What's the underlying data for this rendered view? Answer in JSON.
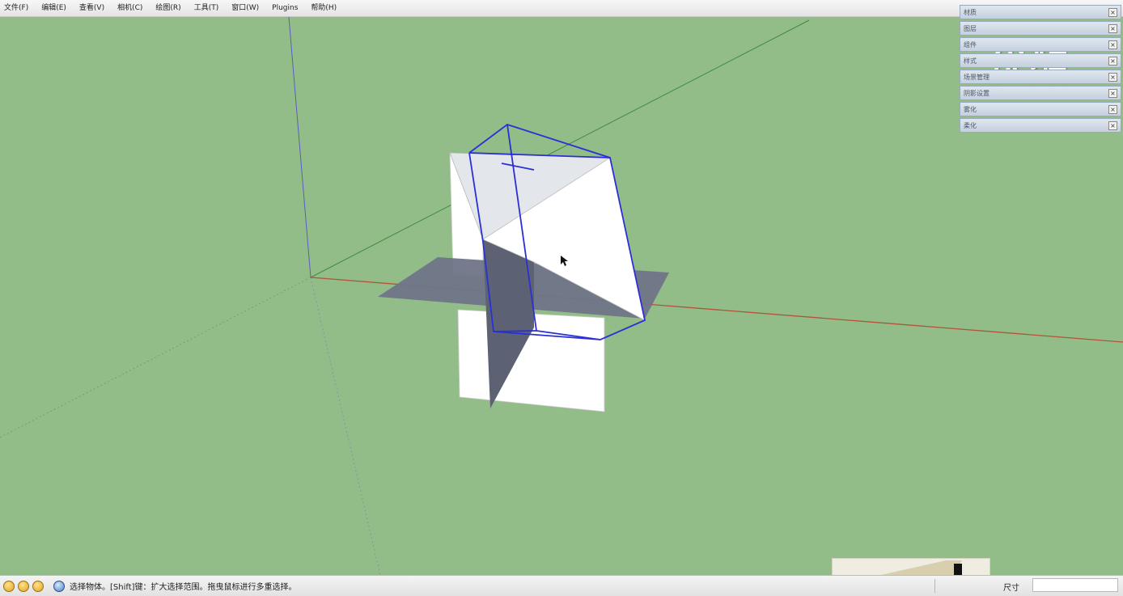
{
  "menu": [
    "文件(F)",
    "编辑(E)",
    "查看(V)",
    "相机(C)",
    "绘图(R)",
    "工具(T)",
    "窗口(W)",
    "Plugins",
    "帮助(H)"
  ],
  "tray": [
    {
      "label": "材质"
    },
    {
      "label": "图层"
    },
    {
      "label": "组件"
    },
    {
      "label": "样式"
    },
    {
      "label": "场景管理"
    },
    {
      "label": "阴影设置"
    },
    {
      "label": "雾化"
    },
    {
      "label": "柔化"
    }
  ],
  "watermark": "优酷",
  "status": {
    "hint": "选择物体。[Shift]键：扩大选择范围。拖曳鼠标进行多重选择。",
    "measure_label": "尺寸",
    "measure_value": ""
  },
  "colors": {
    "viewport_bg": "#93bd88",
    "selection": "#2b2fd6",
    "face_front": "#ffffff",
    "face_back": "#6f7588",
    "axis_red": "#b2523a",
    "axis_green": "#3f8d3c",
    "axis_blue": "#5c5cc2"
  },
  "icons": [
    "tip-icon",
    "tip-icon",
    "tip-icon",
    "help-icon"
  ]
}
